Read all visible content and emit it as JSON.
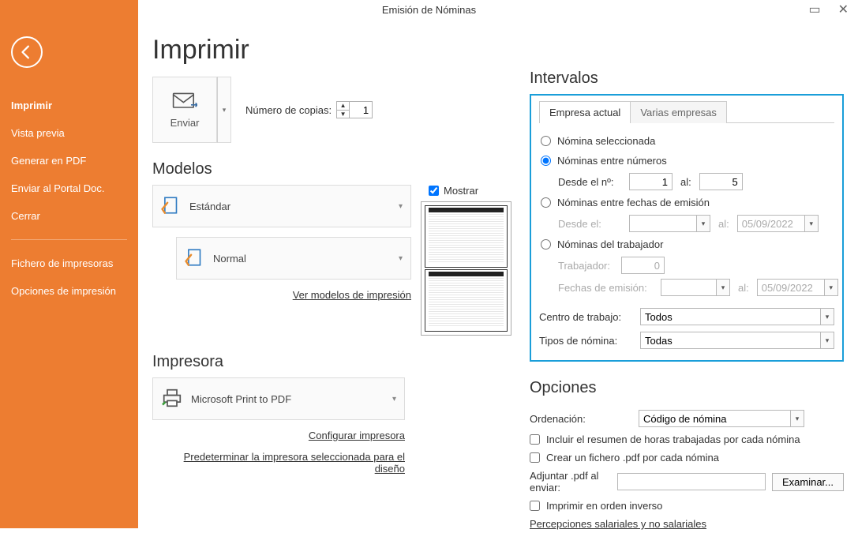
{
  "titlebar": {
    "title": "Emisión de Nóminas"
  },
  "sidebar": {
    "items": [
      "Imprimir",
      "Vista previa",
      "Generar en PDF",
      "Enviar al Portal Doc.",
      "Cerrar"
    ],
    "items2": [
      "Fichero de impresoras",
      "Opciones de impresión"
    ]
  },
  "page": {
    "title": "Imprimir"
  },
  "send": {
    "label": "Enviar",
    "copies_label": "Número de copias:",
    "copies": "1"
  },
  "models": {
    "heading": "Modelos",
    "standard": "Estándar",
    "normal": "Normal",
    "link": "Ver modelos de impresión",
    "show": "Mostrar"
  },
  "printer": {
    "heading": "Impresora",
    "name": "Microsoft Print to PDF",
    "configure": "Configurar impresora",
    "predetermine": "Predeterminar la impresora seleccionada para el diseño"
  },
  "intervals": {
    "heading": "Intervalos",
    "tab1": "Empresa actual",
    "tab2": "Varias empresas",
    "r_sel": "Nómina seleccionada",
    "r_num": "Nóminas entre números",
    "from_no": "Desde el nº:",
    "from_no_val": "1",
    "to": "al:",
    "to_no_val": "5",
    "r_dates": "Nóminas entre fechas de emisión",
    "from_date_lbl": "Desde el:",
    "to_date_val": "05/09/2022",
    "r_worker": "Nóminas del trabajador",
    "worker_lbl": "Trabajador:",
    "worker_val": "0",
    "worker_dates_lbl": "Fechas de emisión:",
    "worker_to_date": "05/09/2022",
    "centro_lbl": "Centro de trabajo:",
    "centro_val": "Todos",
    "tipos_lbl": "Tipos de nómina:",
    "tipos_val": "Todas"
  },
  "options": {
    "heading": "Opciones",
    "orden_lbl": "Ordenación:",
    "orden_val": "Código de nómina",
    "chk_resumen": "Incluir el resumen de horas trabajadas por cada nómina",
    "chk_pdf": "Crear un fichero .pdf por cada nómina",
    "adj_lbl": "Adjuntar .pdf al enviar:",
    "browse": "Examinar...",
    "chk_inverso": "Imprimir en orden inverso",
    "link_perc": "Percepciones salariales y no salariales"
  }
}
